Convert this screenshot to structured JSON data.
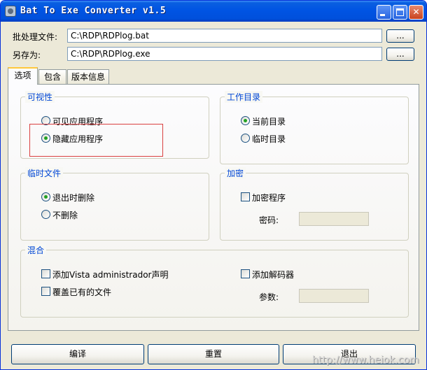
{
  "window": {
    "title": "Bat To Exe Converter v1.5",
    "icon": "app-icon",
    "controls": [
      "minimize-icon",
      "maximize-icon",
      "close-icon"
    ],
    "accent": "#0054e3"
  },
  "files": {
    "batch_label": "批处理文件:",
    "batch_value": "C:\\RDP\\RDPlog.bat",
    "saveas_label": "另存为:",
    "saveas_value": "C:\\RDP\\RDPlog.exe",
    "browse_label": "..."
  },
  "tabs": [
    {
      "label": "选项",
      "active": true
    },
    {
      "label": "包含",
      "active": false
    },
    {
      "label": "版本信息",
      "active": false
    }
  ],
  "visibility": {
    "title": "可视性",
    "options": [
      {
        "label": "可见应用程序",
        "selected": false
      },
      {
        "label": "隐藏应用程序",
        "selected": true
      }
    ]
  },
  "workdir": {
    "title": "工作目录",
    "options": [
      {
        "label": "当前目录",
        "selected": true
      },
      {
        "label": "临时目录",
        "selected": false
      }
    ]
  },
  "tempfiles": {
    "title": "临时文件",
    "options": [
      {
        "label": "退出时删除",
        "selected": true
      },
      {
        "label": "不删除",
        "selected": false
      }
    ]
  },
  "encrypt": {
    "title": "加密",
    "checkbox_label": "加密程序",
    "checked": false,
    "password_label": "密码:",
    "password_value": ""
  },
  "misc": {
    "title": "混合",
    "add_admin_label": "添加Vista administrador声明",
    "overwrite_label": "覆盖已有的文件",
    "add_decoder_label": "添加解码器",
    "params_label": "参数:",
    "params_value": ""
  },
  "buttons": {
    "compile": "编译",
    "reset": "重置",
    "exit": "退出"
  },
  "watermark": "http://www.heiok.com",
  "highlight_color": "#d94040"
}
